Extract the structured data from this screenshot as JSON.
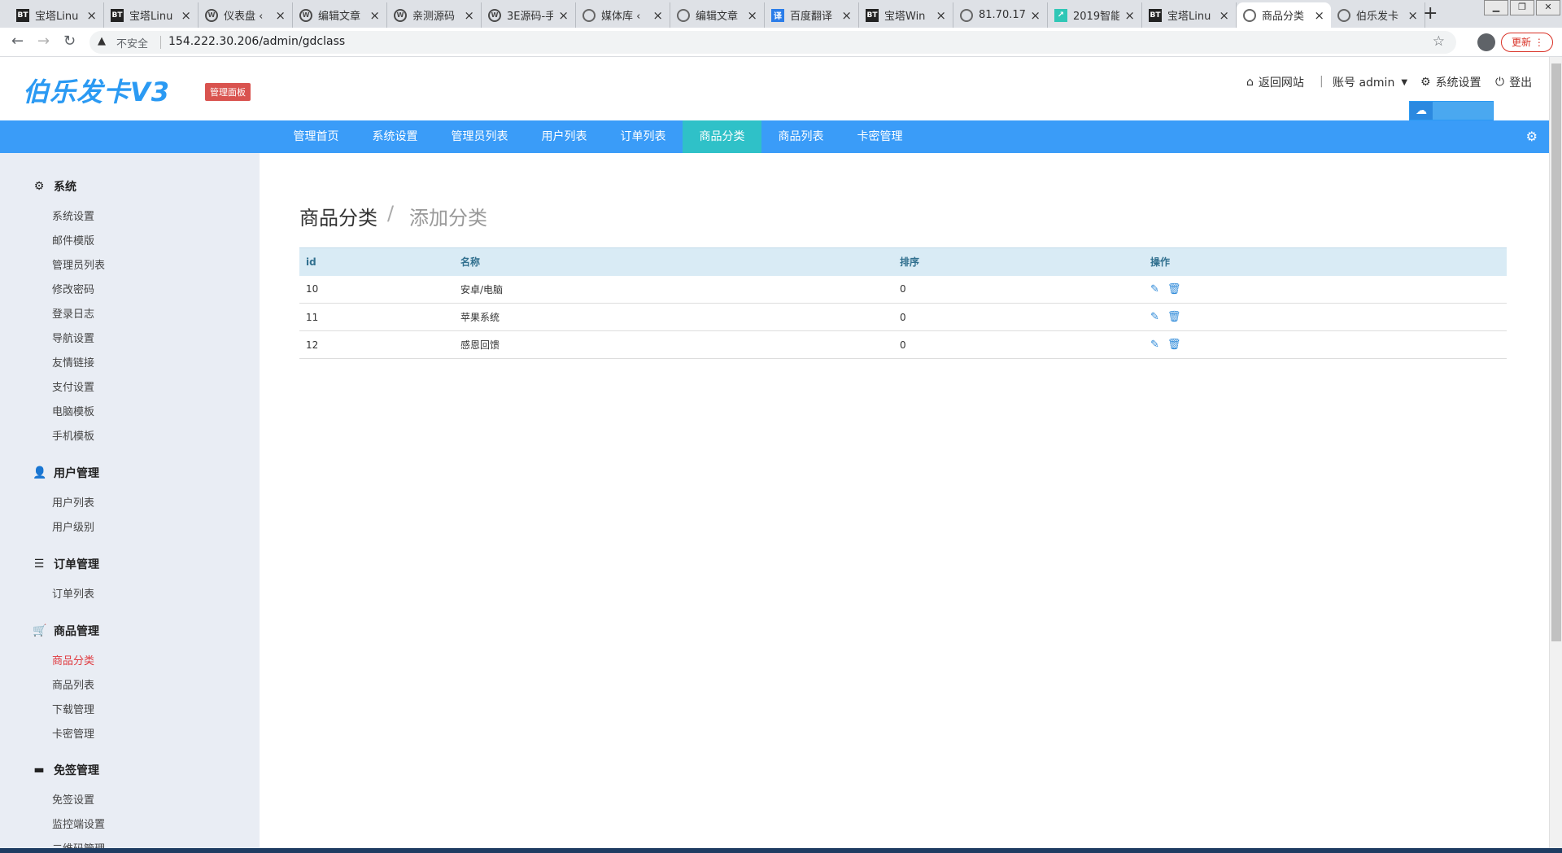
{
  "browser": {
    "tabs": [
      {
        "label": "宝塔Linu",
        "icon": "bt"
      },
      {
        "label": "宝塔Linu",
        "icon": "bt"
      },
      {
        "label": "仪表盘 ‹",
        "icon": "wp"
      },
      {
        "label": "编辑文章",
        "icon": "wp"
      },
      {
        "label": "亲测源码",
        "icon": "wp"
      },
      {
        "label": "3E源码-手",
        "icon": "wp"
      },
      {
        "label": "媒体库 ‹",
        "icon": "globe"
      },
      {
        "label": "编辑文章",
        "icon": "globe"
      },
      {
        "label": "百度翻译",
        "icon": "baidu"
      },
      {
        "label": "宝塔Win",
        "icon": "bt"
      },
      {
        "label": "81.70.17",
        "icon": "globe"
      },
      {
        "label": "2019智能",
        "icon": "chart"
      },
      {
        "label": "宝塔Linu",
        "icon": "bt"
      },
      {
        "label": "商品分类",
        "icon": "globe"
      },
      {
        "label": "伯乐发卡",
        "icon": "globe"
      }
    ],
    "bt_glyph": "BT",
    "wp_glyph": "W",
    "baidu_glyph": "译",
    "chart_glyph": "↗",
    "close_glyph": "×",
    "new_tab_glyph": "+",
    "insecure_label": "不安全",
    "url": "154.222.30.206/admin/gdclass",
    "update_label": "更新",
    "update_more": "⋮"
  },
  "header": {
    "logo": "伯乐发卡V3",
    "badge": "管理面板",
    "back_site": "返回网站",
    "separator": "|",
    "account": "账号 admin",
    "settings": "系统设置",
    "logout": "登出"
  },
  "nav": {
    "items": [
      "管理首页",
      "系统设置",
      "管理员列表",
      "用户列表",
      "订单列表",
      "商品分类",
      "商品列表",
      "卡密管理"
    ],
    "active": "商品分类"
  },
  "sidebar": {
    "groups": [
      {
        "title": "系统",
        "icon": "gear-icon",
        "items": [
          "系统设置",
          "邮件模版",
          "管理员列表",
          "修改密码",
          "登录日志",
          "导航设置",
          "友情链接",
          "支付设置",
          "电脑模板",
          "手机模板"
        ]
      },
      {
        "title": "用户管理",
        "icon": "user-icon",
        "items": [
          "用户列表",
          "用户级别"
        ]
      },
      {
        "title": "订单管理",
        "icon": "list-icon",
        "items": [
          "订单列表"
        ]
      },
      {
        "title": "商品管理",
        "icon": "cart-icon",
        "items": [
          "商品分类",
          "商品列表",
          "下载管理",
          "卡密管理"
        ]
      },
      {
        "title": "免签管理",
        "icon": "card-icon",
        "items": [
          "免签设置",
          "监控端设置",
          "二维码管理"
        ]
      }
    ],
    "active_item": "商品分类"
  },
  "content": {
    "breadcrumb_title": "商品分类",
    "breadcrumb_sep": "/",
    "breadcrumb_add": "添加分类",
    "table": {
      "headers": [
        "id",
        "名称",
        "排序",
        "操作"
      ],
      "rows": [
        {
          "id": "10",
          "name": "安卓/电脑",
          "sort": "0"
        },
        {
          "id": "11",
          "name": "苹果系统",
          "sort": "0"
        },
        {
          "id": "12",
          "name": "感恩回馈",
          "sort": "0"
        }
      ]
    }
  }
}
